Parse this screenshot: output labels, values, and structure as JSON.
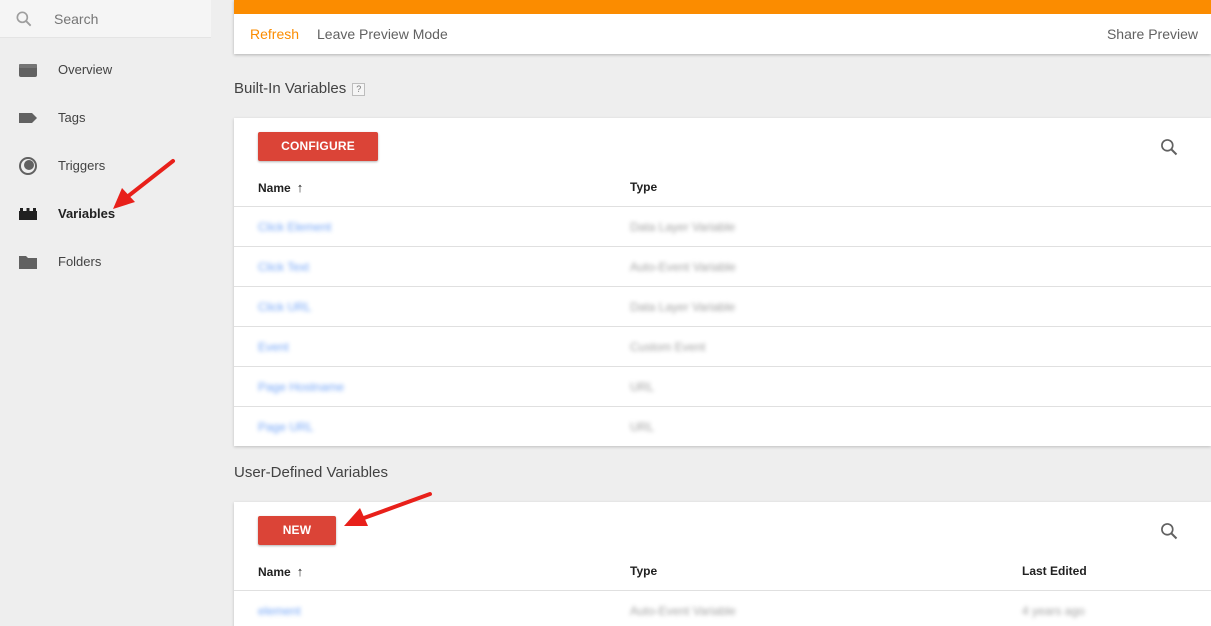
{
  "sidebar": {
    "search_placeholder": "Search",
    "items": [
      {
        "label": "Overview",
        "icon": "overview-icon"
      },
      {
        "label": "Tags",
        "icon": "tag-icon"
      },
      {
        "label": "Triggers",
        "icon": "trigger-icon"
      },
      {
        "label": "Variables",
        "icon": "variables-icon",
        "active": true
      },
      {
        "label": "Folders",
        "icon": "folder-icon"
      }
    ]
  },
  "preview_bar": {
    "refresh_label": "Refresh",
    "leave_label": "Leave Preview Mode",
    "share_label": "Share Preview",
    "accent_color": "#fb8c00"
  },
  "builtin": {
    "title": "Built-In Variables",
    "help": "?",
    "button_label": "CONFIGURE",
    "columns": {
      "name": "Name",
      "type": "Type"
    },
    "sort_indicator": "↑",
    "rows": [
      {
        "name": "Click Element",
        "type": "Data Layer Variable"
      },
      {
        "name": "Click Text",
        "type": "Auto-Event Variable"
      },
      {
        "name": "Click URL",
        "type": "Data Layer Variable"
      },
      {
        "name": "Event",
        "type": "Custom Event"
      },
      {
        "name": "Page Hostname",
        "type": "URL"
      },
      {
        "name": "Page URL",
        "type": "URL"
      }
    ]
  },
  "user_defined": {
    "title": "User-Defined Variables",
    "button_label": "NEW",
    "columns": {
      "name": "Name",
      "type": "Type",
      "last_edited": "Last Edited"
    },
    "sort_indicator": "↑",
    "rows": [
      {
        "name": "element",
        "type": "Auto-Event Variable",
        "last_edited": "4 years ago"
      }
    ]
  },
  "colors": {
    "button_red": "#db4437",
    "link_blue": "#4285f4",
    "annotation_arrow": "#e8201a"
  }
}
